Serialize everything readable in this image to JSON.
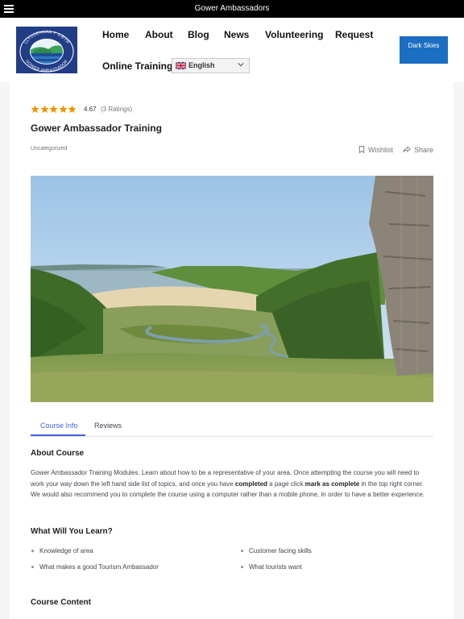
{
  "topbar": {
    "title": "Gower Ambassadors"
  },
  "header": {
    "logo": {
      "arc_text_top": "LLYSGENNAD Y GŴYR",
      "arc_text_bottom": "GOWER AMBASSADOR"
    },
    "nav": [
      {
        "label": "Home"
      },
      {
        "label": "About"
      },
      {
        "label": "Blog"
      },
      {
        "label": "News"
      },
      {
        "label": "Volunteering"
      },
      {
        "label": "Request"
      },
      {
        "label": "Online Training"
      }
    ],
    "language": {
      "selected": "English",
      "flag_icon": "uk-flag-icon"
    },
    "dark_skies_button": "Dark Skies",
    "dark_skies_color": "#1b6ec2"
  },
  "course": {
    "rating": {
      "value": "4.67",
      "count_label": "(3 Ratings)",
      "stars": 5,
      "star_color": "#ed9700"
    },
    "title": "Gower Ambassador Training",
    "category": "Uncategorized",
    "actions": {
      "wishlist": "Wishlist",
      "share": "Share"
    },
    "hero_image": {
      "alt_semantic": "gower-valley-landscape"
    },
    "tabs": [
      {
        "label": "Course Info",
        "active": true
      },
      {
        "label": "Reviews",
        "active": false
      }
    ],
    "accent_color": "#3e64de",
    "about": {
      "heading": "About Course",
      "text_parts": [
        "Gower Ambassador Training Modules. Learn about how to be a representative of your area. Once attempting the course you will need to work your way down the left hand side list of topics, and once you have ",
        "completed",
        " a page click ",
        "mark as complete",
        " in the top right corner. We would also recommend you to complete the course using a computer rather than a mobile phone, in order to have a better experience."
      ]
    },
    "learn": {
      "heading": "What Will You Learn?",
      "items": [
        "Knowledge of area",
        "Customer facing skills",
        "What makes a good Tourism Ambassador",
        "What tourists want"
      ]
    },
    "content": {
      "heading": "Course Content"
    }
  }
}
